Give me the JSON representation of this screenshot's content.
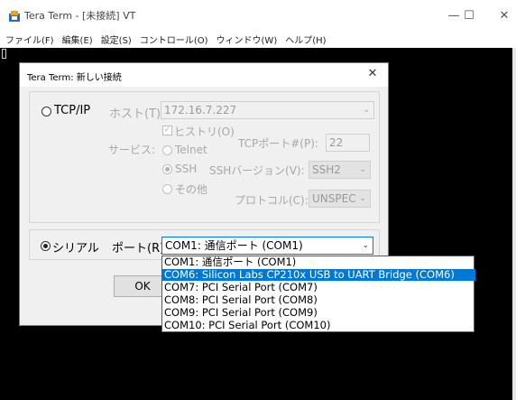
{
  "window": {
    "title": "Tera Term - [未接続] VT",
    "controls": {
      "minimize": "—",
      "maximize": "☐",
      "close": "✕"
    }
  },
  "menu": {
    "items": [
      {
        "label": "ファイル(F)"
      },
      {
        "label": "編集(E)"
      },
      {
        "label": "設定(S)"
      },
      {
        "label": "コントロール(O)"
      },
      {
        "label": "ウィンドウ(W)"
      },
      {
        "label": "ヘルプ(H)"
      }
    ]
  },
  "dialog": {
    "title": "Tera Term: 新しい接続",
    "close": "✕",
    "tcpip": {
      "radio_label": "TCP/IP",
      "selected": false,
      "host_label": "ホスト(T):",
      "host_value": "172.16.7.227",
      "history_label": "ヒストリ(O)",
      "history_checked": true,
      "service_label": "サービス:",
      "services": [
        {
          "label": "Telnet",
          "selected": false
        },
        {
          "label": "SSH",
          "selected": true
        },
        {
          "label": "その他",
          "selected": false
        }
      ],
      "tcp_port_label": "TCPポート#(P):",
      "tcp_port_value": "22",
      "ssh_version_label": "SSHバージョン(V):",
      "ssh_version_value": "SSH2",
      "protocol_label": "プロトコル(C):",
      "protocol_value": "UNSPEC"
    },
    "serial": {
      "radio_label": "シリアル",
      "selected": true,
      "port_label": "ポート(R):",
      "port_value": "COM1: 通信ポート (COM1)",
      "dropdown_options": [
        {
          "label": "COM1: 通信ポート (COM1)",
          "highlighted": false
        },
        {
          "label": "COM6: Silicon Labs CP210x USB to UART Bridge (COM6)",
          "highlighted": true
        },
        {
          "label": "COM7: PCI Serial Port (COM7)",
          "highlighted": false
        },
        {
          "label": "COM8: PCI Serial Port (COM8)",
          "highlighted": false
        },
        {
          "label": "COM9: PCI Serial Port (COM9)",
          "highlighted": false
        },
        {
          "label": "COM10: PCI Serial Port (COM10)",
          "highlighted": false
        }
      ]
    },
    "ok_label": "OK"
  },
  "colors": {
    "accent": "#0078d7",
    "terminal_bg": "#000000",
    "dialog_bg": "#f0f0f0",
    "disabled_text": "#a8a8a8"
  },
  "icons": {
    "app": "tera-term-app-icon",
    "chevron": "chevron-down-icon"
  }
}
